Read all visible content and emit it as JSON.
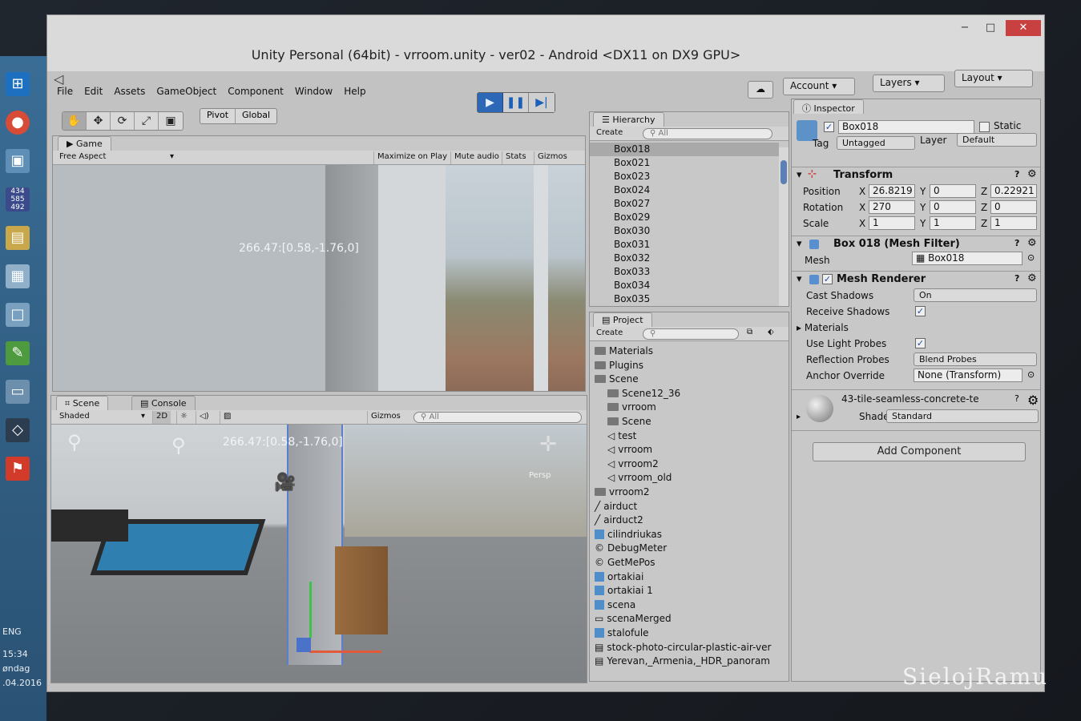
{
  "window": {
    "title": "Unity Personal (64bit) - vrroom.unity - ver02 - Android <DX11 on DX9 GPU>",
    "min": "−",
    "max": "□",
    "close": "✕"
  },
  "menu": [
    "File",
    "Edit",
    "Assets",
    "GameObject",
    "Component",
    "Window",
    "Help"
  ],
  "toolbar": {
    "pivot": "Pivot",
    "global": "Global",
    "account": "Account",
    "layers": "Layers",
    "layout": "Layout"
  },
  "game": {
    "tab": "Game",
    "aspect": "Free Aspect",
    "buttons": [
      "Maximize on Play",
      "Mute audio",
      "Stats",
      "Gizmos"
    ],
    "overlay": "266.47:[0.58,-1.76,0]"
  },
  "scene": {
    "tab": "Scene",
    "console_tab": "Console",
    "mode": "Shaded",
    "two_d": "2D",
    "gizmos": "Gizmos",
    "search": "All",
    "overlay": "266.47:[0.58,-1.76,0]",
    "persp": "Persp"
  },
  "hierarchy": {
    "tab": "Hierarchy",
    "create": "Create",
    "search": "All",
    "items": [
      "Box018",
      "Box021",
      "Box023",
      "Box024",
      "Box027",
      "Box029",
      "Box030",
      "Box031",
      "Box032",
      "Box033",
      "Box034",
      "Box035"
    ]
  },
  "project": {
    "tab": "Project",
    "create": "Create",
    "items": [
      {
        "label": "Materials",
        "kind": "folder",
        "indent": 0
      },
      {
        "label": "Plugins",
        "kind": "folder",
        "indent": 0
      },
      {
        "label": "Scene",
        "kind": "folder",
        "indent": 0
      },
      {
        "label": "Scene12_36",
        "kind": "folder",
        "indent": 1
      },
      {
        "label": "vrroom",
        "kind": "folder",
        "indent": 1
      },
      {
        "label": "Scene",
        "kind": "folder",
        "indent": 1
      },
      {
        "label": "test",
        "kind": "unity",
        "indent": 1
      },
      {
        "label": "vrroom",
        "kind": "unity",
        "indent": 1
      },
      {
        "label": "vrroom2",
        "kind": "unity",
        "indent": 1
      },
      {
        "label": "vrroom_old",
        "kind": "unity",
        "indent": 1
      },
      {
        "label": "vrroom2",
        "kind": "folder",
        "indent": 0
      },
      {
        "label": "airduct",
        "kind": "mesh",
        "indent": 0
      },
      {
        "label": "airduct2",
        "kind": "mesh",
        "indent": 0
      },
      {
        "label": "cilindriukas",
        "kind": "prefab",
        "indent": 0
      },
      {
        "label": "DebugMeter",
        "kind": "script",
        "indent": 0
      },
      {
        "label": "GetMePos",
        "kind": "script",
        "indent": 0
      },
      {
        "label": "ortakiai",
        "kind": "prefab",
        "indent": 0
      },
      {
        "label": "ortakiai 1",
        "kind": "prefab",
        "indent": 0
      },
      {
        "label": "scena",
        "kind": "prefab",
        "indent": 0
      },
      {
        "label": "scenaMerged",
        "kind": "file",
        "indent": 0
      },
      {
        "label": "stalofule",
        "kind": "prefab",
        "indent": 0
      },
      {
        "label": "stock-photo-circular-plastic-air-ver",
        "kind": "image",
        "indent": 0
      },
      {
        "label": "Yerevan,_Armenia,_HDR_panoram",
        "kind": "image",
        "indent": 0
      }
    ]
  },
  "inspector": {
    "tab": "Inspector",
    "name": "Box018",
    "static_label": "Static",
    "tag_label": "Tag",
    "tag": "Untagged",
    "layer_label": "Layer",
    "layer": "Default",
    "transform": {
      "title": "Transform",
      "position_label": "Position",
      "rotation_label": "Rotation",
      "scale_label": "Scale",
      "position": [
        "26.8219",
        "0",
        "0.22921"
      ],
      "rotation": [
        "270",
        "0",
        "0"
      ],
      "scale": [
        "1",
        "1",
        "1"
      ]
    },
    "mesh_filter": {
      "title": "Box 018 (Mesh Filter)",
      "mesh_label": "Mesh",
      "mesh": "Box018"
    },
    "mesh_renderer": {
      "title": "Mesh Renderer",
      "cast_shadows_label": "Cast Shadows",
      "cast_shadows": "On",
      "receive_shadows_label": "Receive Shadows",
      "materials_label": "Materials",
      "light_probes_label": "Use Light Probes",
      "reflection_label": "Reflection Probes",
      "reflection": "Blend Probes",
      "anchor_label": "Anchor Override",
      "anchor": "None (Transform)"
    },
    "material": {
      "name": "43-tile-seamless-concrete-te",
      "shader_label": "Shader",
      "shader": "Standard"
    },
    "add_component": "Add Component"
  },
  "taskbar": {
    "lang": "ENG",
    "time": "15:34",
    "day": "øndag",
    "date": ".04.2016"
  },
  "watermark": "SielojRamu"
}
